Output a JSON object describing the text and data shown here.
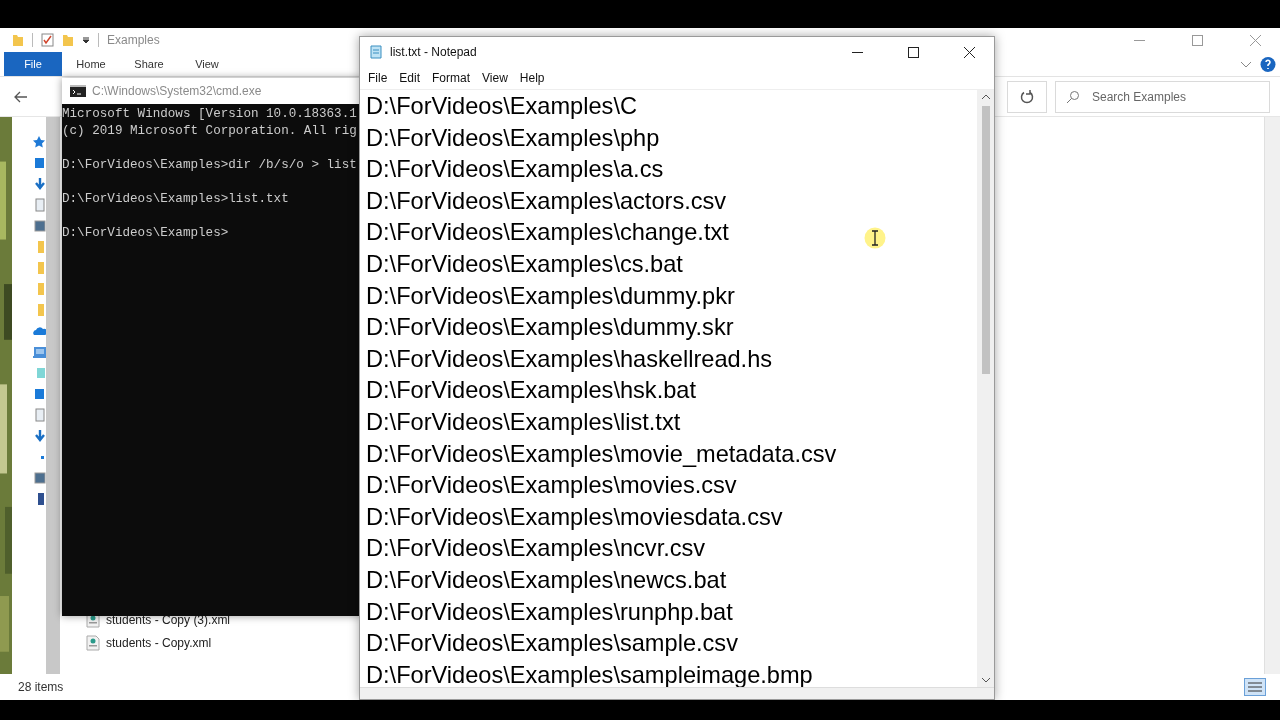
{
  "explorer": {
    "title": "Examples",
    "tabs": [
      {
        "label": "File",
        "selected": true
      },
      {
        "label": "Home",
        "selected": false
      },
      {
        "label": "Share",
        "selected": false
      },
      {
        "label": "View",
        "selected": false
      }
    ],
    "search": {
      "placeholder": "Search Examples"
    },
    "files": [
      {
        "name": "students - Copy (3).xml"
      },
      {
        "name": "students - Copy.xml"
      }
    ],
    "status": "28 items"
  },
  "console": {
    "title": "C:\\Windows\\System32\\cmd.exe",
    "blocks": [
      [
        "Microsoft Windows [Version 10.0.18363.1",
        "(c) 2019 Microsoft Corporation. All rig"
      ],
      [
        "D:\\ForVideos\\Examples>dir /b/s/o > list"
      ],
      [
        "D:\\ForVideos\\Examples>list.txt"
      ],
      [
        "D:\\ForVideos\\Examples>"
      ]
    ]
  },
  "notepad": {
    "title": "list.txt - Notepad",
    "menu": [
      "File",
      "Edit",
      "Format",
      "View",
      "Help"
    ],
    "lines": [
      "D:\\ForVideos\\Examples\\C",
      "D:\\ForVideos\\Examples\\php",
      "D:\\ForVideos\\Examples\\a.cs",
      "D:\\ForVideos\\Examples\\actors.csv",
      "D:\\ForVideos\\Examples\\change.txt",
      "D:\\ForVideos\\Examples\\cs.bat",
      "D:\\ForVideos\\Examples\\dummy.pkr",
      "D:\\ForVideos\\Examples\\dummy.skr",
      "D:\\ForVideos\\Examples\\haskellread.hs",
      "D:\\ForVideos\\Examples\\hsk.bat",
      "D:\\ForVideos\\Examples\\list.txt",
      "D:\\ForVideos\\Examples\\movie_metadata.csv",
      "D:\\ForVideos\\Examples\\movies.csv",
      "D:\\ForVideos\\Examples\\moviesdata.csv",
      "D:\\ForVideos\\Examples\\ncvr.csv",
      "D:\\ForVideos\\Examples\\newcs.bat",
      "D:\\ForVideos\\Examples\\runphp.bat",
      "D:\\ForVideos\\Examples\\sample.csv",
      "D:\\ForVideos\\Examples\\sampleimage.bmp"
    ]
  }
}
